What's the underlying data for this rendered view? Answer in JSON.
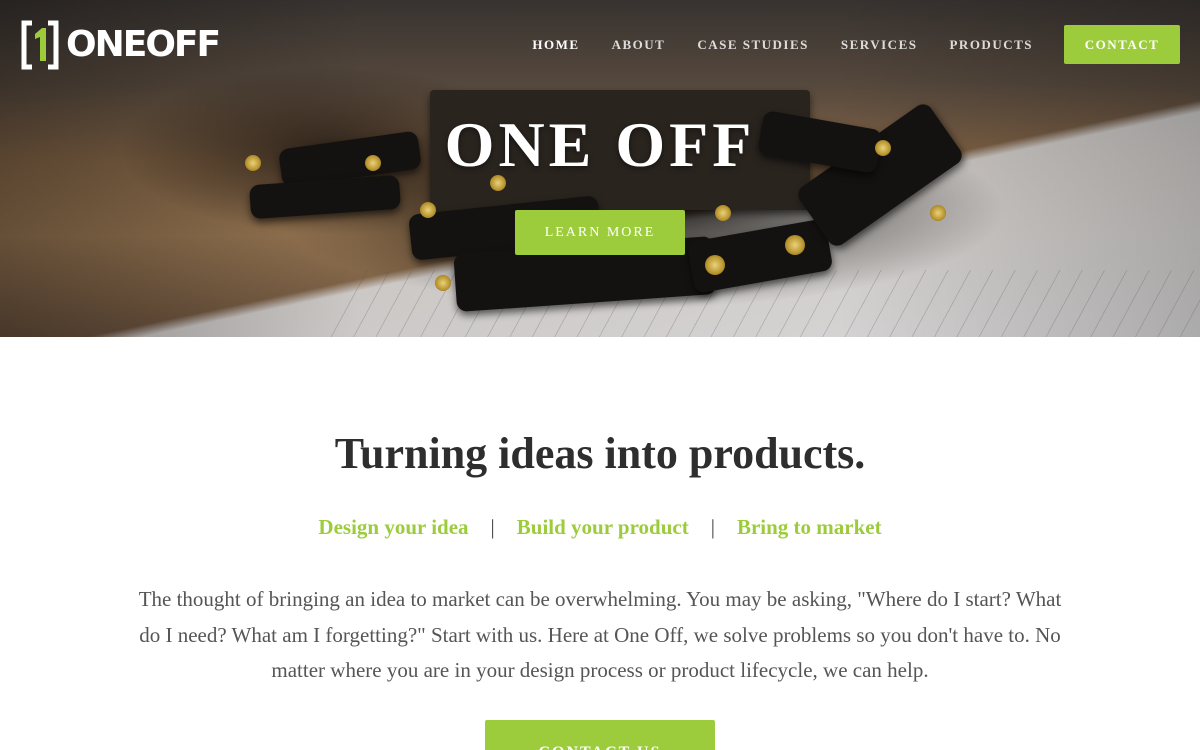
{
  "brand": {
    "name": "ONE OFF",
    "logo_text": "ONEOFF",
    "accent": "#9ccc3c"
  },
  "nav": {
    "items": [
      {
        "label": "HOME",
        "active": true
      },
      {
        "label": "ABOUT",
        "active": false
      },
      {
        "label": "CASE STUDIES",
        "active": false
      },
      {
        "label": "SERVICES",
        "active": false
      },
      {
        "label": "PRODUCTS",
        "active": false
      }
    ],
    "contact_label": "CONTACT"
  },
  "hero": {
    "title": "ONE OFF",
    "button_label": "LEARN MORE"
  },
  "content": {
    "headline": "Turning ideas into products.",
    "steps": [
      "Design your idea",
      "Build your product",
      "Bring to market"
    ],
    "separator": "|",
    "paragraph": "The thought of bringing an idea to market can be overwhelming. You may be asking, \"Where do I start? What do I need? What am I forgetting?\" Start with us. Here at One Off, we solve problems so you don't have to. No matter where you are in your design process or product lifecycle, we can help.",
    "cta_label": "CONTACT US"
  }
}
